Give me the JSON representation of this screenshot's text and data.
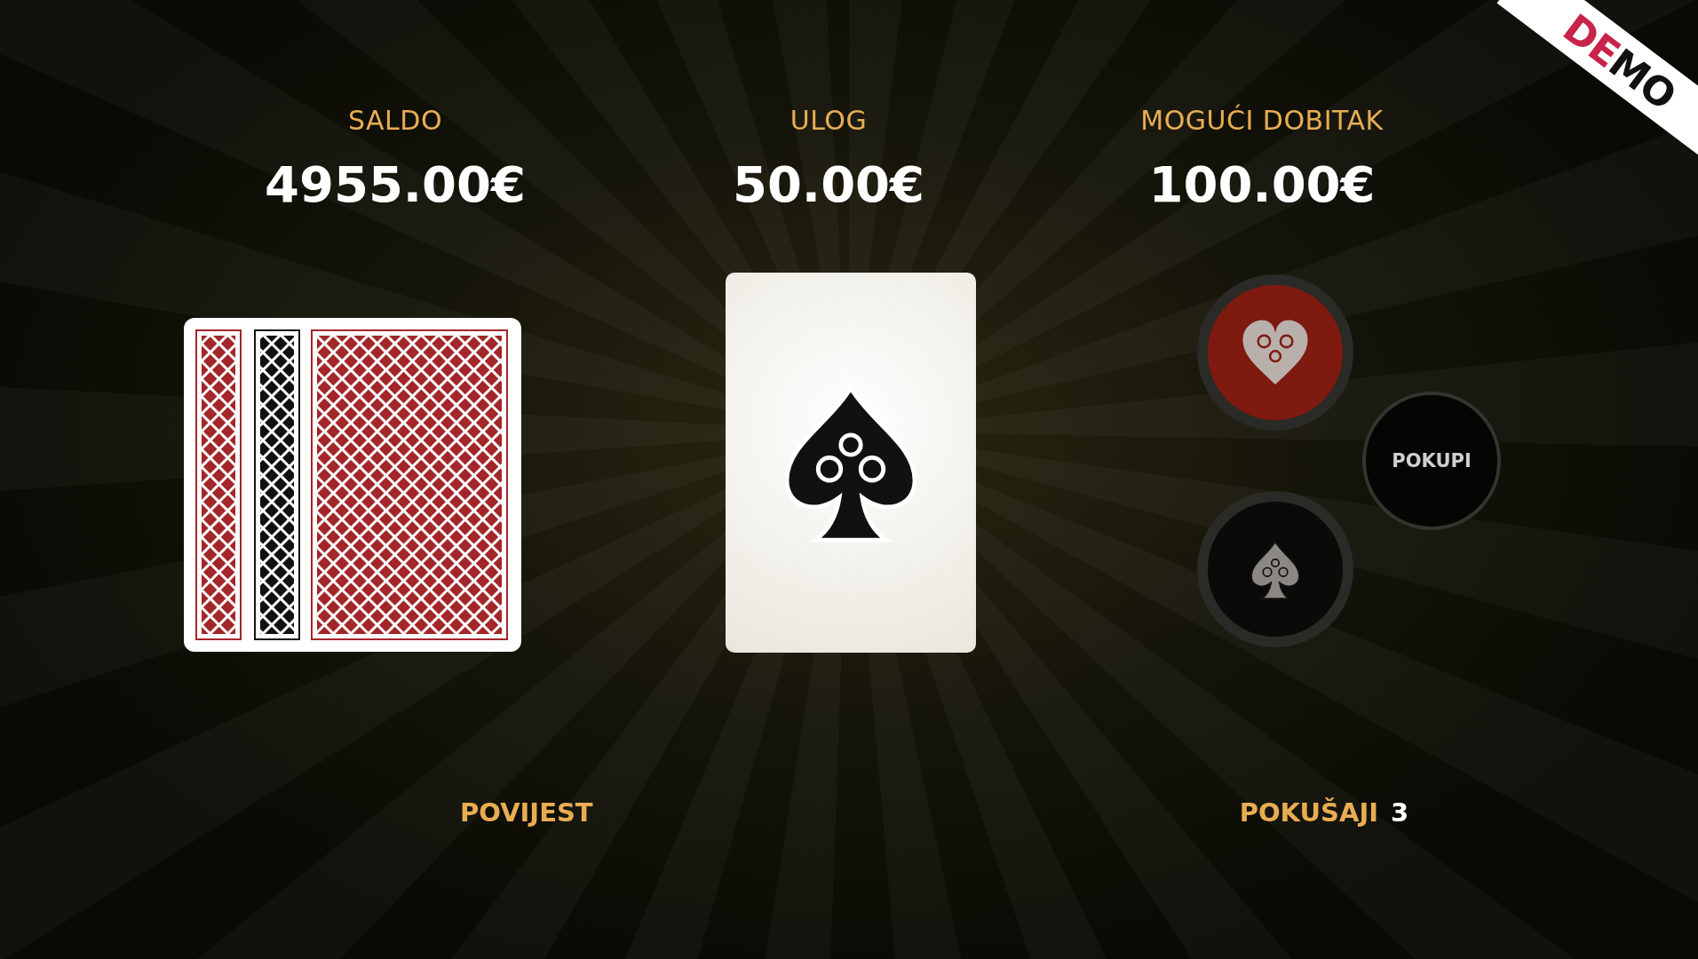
{
  "stats": [
    {
      "label": "SALDO",
      "value": "4955.00€"
    },
    {
      "label": "ULOG",
      "value": "50.00€"
    },
    {
      "label": "MOGUĆI DOBITAK",
      "value": "100.00€"
    }
  ],
  "card": {
    "kind": "spade"
  },
  "choices": [
    {
      "kind": "heart",
      "selected": true
    },
    {
      "kind": "spade",
      "selected": false
    }
  ],
  "collect_button": "POKUPI",
  "history_link": "POVIJEST",
  "attempts": {
    "label": "POKUŠAJI",
    "count": "3"
  },
  "demo_ribbon": [
    {
      "text": "DE",
      "color": "#c8234a"
    },
    {
      "text": "MO",
      "color": "#111111"
    }
  ]
}
